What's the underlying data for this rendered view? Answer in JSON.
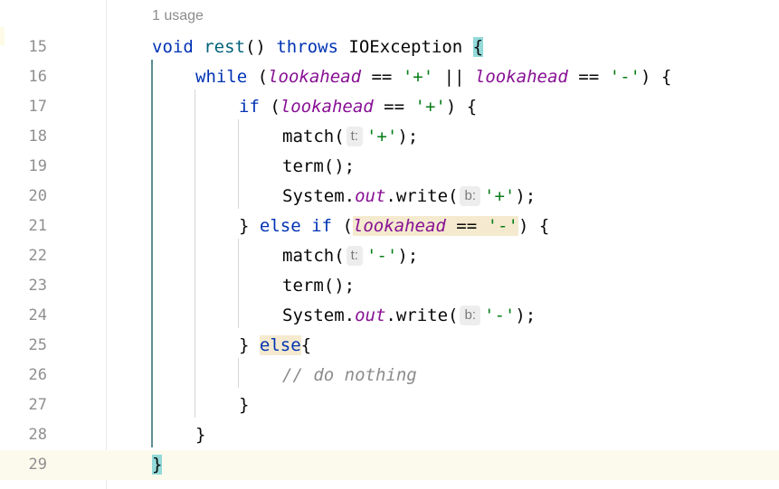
{
  "usage_hint": "1 usage",
  "line_numbers": [
    "15",
    "16",
    "17",
    "18",
    "19",
    "20",
    "21",
    "22",
    "23",
    "24",
    "25",
    "26",
    "27",
    "28",
    "29"
  ],
  "code": {
    "l15": {
      "void": "void",
      "rest": "rest",
      "sig": "() ",
      "throws": "throws",
      "exc": " IOException ",
      "brace": "{"
    },
    "l16": {
      "while": "while",
      "open": " (",
      "la1": "lookahead",
      "eq1": " == ",
      "plus": "'+'",
      "or": " || ",
      "la2": "lookahead",
      "eq2": " == ",
      "minus": "'-'",
      "close": ") {"
    },
    "l17": {
      "if": "if",
      "open": " (",
      "la": "lookahead",
      "eq": " == ",
      "plus": "'+'",
      "close": ") {"
    },
    "l18": {
      "call": "match(",
      "hint": "t:",
      "arg": "'+'",
      "end": ");"
    },
    "l19": {
      "call": "term();"
    },
    "l20": {
      "sys": "System.",
      "out": "out",
      "write": ".write(",
      "hint": "b:",
      "arg": "'+'",
      "end": ");"
    },
    "l21": {
      "rb": "} ",
      "else": "else",
      "sp": " ",
      "if": "if",
      "open": " (",
      "la": "lookahead",
      "eq": " == ",
      "minus": "'-'",
      "close": ") {"
    },
    "l22": {
      "call": "match(",
      "hint": "t:",
      "arg": "'-'",
      "end": ");"
    },
    "l23": {
      "call": "term();"
    },
    "l24": {
      "sys": "System.",
      "out": "out",
      "write": ".write(",
      "hint": "b:",
      "arg": "'-'",
      "end": ");"
    },
    "l25": {
      "rb": "} ",
      "else": "else",
      "brace": "{"
    },
    "l26": {
      "comment": "// do nothing"
    },
    "l27": {
      "brace": "}"
    },
    "l28": {
      "brace": "}"
    },
    "l29": {
      "brace": "}"
    }
  },
  "colors": {
    "keyword": "#0033b3",
    "method": "#00627a",
    "field": "#871094",
    "string": "#067d17",
    "comment": "#8c8c8c",
    "brace_match": "#93d9d9",
    "current_line": "#fcfaed"
  }
}
